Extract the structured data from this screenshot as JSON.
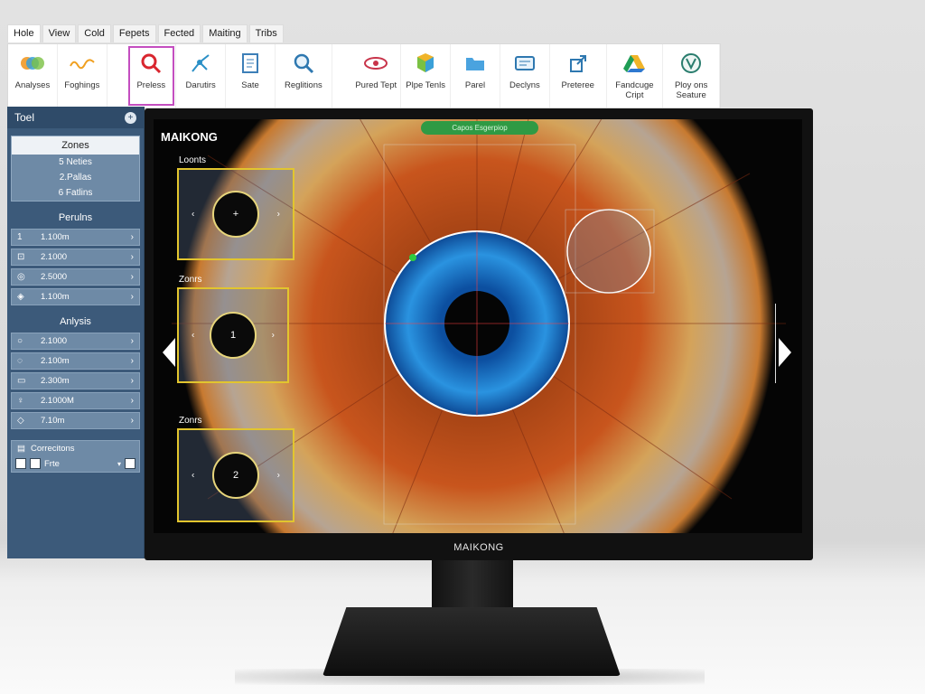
{
  "menu": [
    "Hole",
    "View",
    "Cold",
    "Fepets",
    "Fected",
    "Maiting",
    "Tribs"
  ],
  "ribbon": [
    {
      "label": "Analyses",
      "icon": "rings-icon"
    },
    {
      "label": "Foghings",
      "icon": "wave-icon"
    },
    {
      "label": "Preless",
      "icon": "magnifier-icon",
      "selected": true
    },
    {
      "label": "Darutirs",
      "icon": "branch-icon"
    },
    {
      "label": "Sate",
      "icon": "document-icon"
    },
    {
      "label": "Reglitions",
      "icon": "search-icon"
    },
    {
      "label": "Pured Tept",
      "icon": "eye-icon"
    },
    {
      "label": "Plpe Tenls",
      "icon": "cube-icon"
    },
    {
      "label": "Parel",
      "icon": "folder-icon"
    },
    {
      "label": "Declyns",
      "icon": "card-icon"
    },
    {
      "label": "Preteree",
      "icon": "share-icon"
    },
    {
      "label": "Fandcuge Cript",
      "icon": "drive-icon"
    },
    {
      "label": "Ploy ons Seature",
      "icon": "circle-v-icon"
    }
  ],
  "sidebar": {
    "title": "Toel",
    "zones": {
      "title": "Zones",
      "items": [
        "5 Neties",
        "2.Pallas",
        "6 Fatlins"
      ]
    },
    "perlins": {
      "title": "Perulns",
      "rows": [
        {
          "icon": "1",
          "value": "1.100m"
        },
        {
          "icon": "⊡",
          "value": "2.1000"
        },
        {
          "icon": "◎",
          "value": "2.5000"
        },
        {
          "icon": "◈",
          "value": "1.100m"
        }
      ]
    },
    "analysis": {
      "title": "Anlysis",
      "rows": [
        {
          "icon": "○",
          "value": "2.1000"
        },
        {
          "icon": "◌",
          "value": "2.100m"
        },
        {
          "icon": "▭",
          "value": "2.300m"
        },
        {
          "icon": "♀",
          "value": "2.1000M"
        },
        {
          "icon": "◇",
          "value": "7.10m"
        }
      ]
    },
    "corrections": {
      "title": "Correcitons",
      "value": "Frte"
    }
  },
  "screen": {
    "title": "MAIKONG",
    "pill_text": "Capos Esgerpiop",
    "zone_labels": [
      "Loonts",
      "Zonrs",
      "Zonrs"
    ],
    "zone_marks": [
      "+",
      "1",
      "2"
    ]
  },
  "monitor_brand": "MAIKONG",
  "colors": {
    "sidebar": "#3c5a7a",
    "accent": "#e2c52e",
    "pill": "#2f9a44",
    "iris_blue": "#1f7fd4",
    "iris_orange": "#c8551d"
  }
}
